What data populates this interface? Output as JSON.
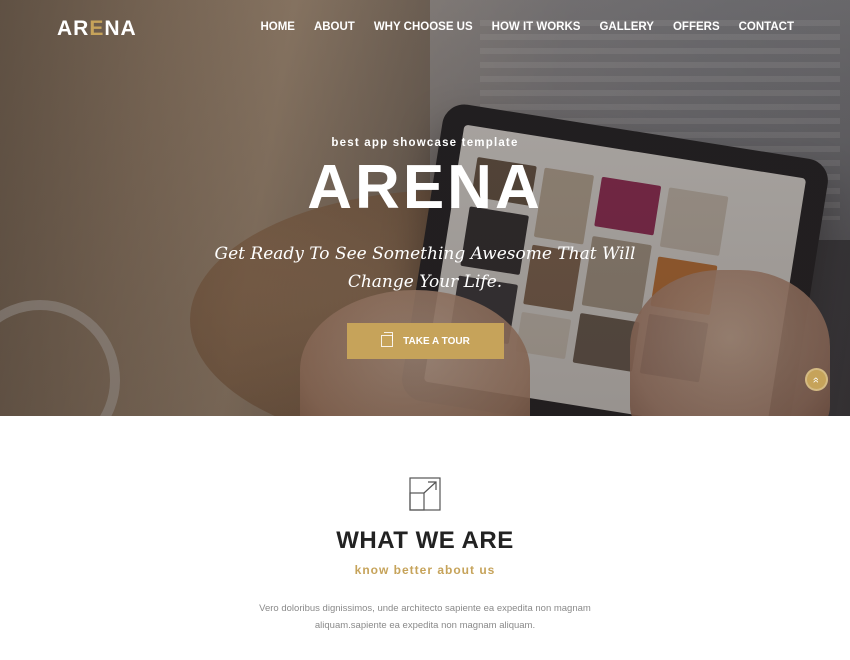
{
  "brand": {
    "logo_prefix": "AR",
    "logo_accent": "E",
    "logo_suffix": "NA",
    "accent_color": "#c6a35a"
  },
  "nav": {
    "items": [
      "HOME",
      "ABOUT",
      "WHY CHOOSE US",
      "HOW IT WORKS",
      "GALLERY",
      "OFFERS",
      "CONTACT"
    ]
  },
  "hero": {
    "kicker": "best app showcase template",
    "title": "ARENA",
    "tagline": "Get Ready To See Something Awesome That Will Change Your Life.",
    "cta_label": "TAKE A TOUR",
    "cta_icon": "external-link-icon"
  },
  "scroll_top": {
    "icon": "double-chevron-up-icon",
    "glyph": "»"
  },
  "about": {
    "icon": "expand-arrow-icon",
    "title": "WHAT WE ARE",
    "subtitle": "know better about us",
    "text": "Vero doloribus dignissimos, unde architecto sapiente ea expedita non magnam aliquam.sapiente ea expedita non magnam aliquam."
  }
}
